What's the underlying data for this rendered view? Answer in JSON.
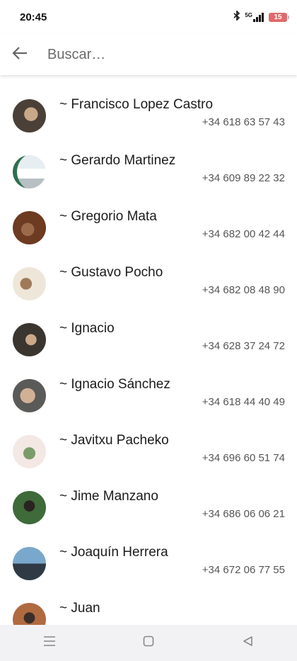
{
  "status_bar": {
    "time": "20:45",
    "battery": "15",
    "network": "5G"
  },
  "search": {
    "placeholder": "Buscar…",
    "value": ""
  },
  "contacts": [
    {
      "name": "~ Francisco Lopez Castro",
      "phone": "+34 618 63 57 43",
      "avatar_colors": [
        "#4a4038",
        "#c8a888"
      ]
    },
    {
      "name": "~ Gerardo Martinez",
      "phone": "+34 609 89 22 32",
      "avatar_colors": [
        "#e6eef2",
        "#2d6f4e"
      ]
    },
    {
      "name": "~ Gregorio Mata",
      "phone": "+34 682 00 42 44",
      "avatar_colors": [
        "#6d3a22",
        "#9a6a4a"
      ]
    },
    {
      "name": "~ Gustavo Pocho",
      "phone": "+34 682 08 48 90",
      "avatar_colors": [
        "#efe6da",
        "#a07a58"
      ]
    },
    {
      "name": "~ Ignacio",
      "phone": "+34 628 37 24 72",
      "avatar_colors": [
        "#3b3530",
        "#caa98a"
      ]
    },
    {
      "name": "~ Ignacio Sánchez",
      "phone": "+34 618 44 40 49",
      "avatar_colors": [
        "#5a5a58",
        "#d2b096"
      ]
    },
    {
      "name": "~ Javitxu Pacheko",
      "phone": "+34 696 60 51 74",
      "avatar_colors": [
        "#f3e8e4",
        "#7a9c6a"
      ]
    },
    {
      "name": "~ Jime Manzano",
      "phone": "+34 686 06 06 21",
      "avatar_colors": [
        "#3f6a3a",
        "#2a2420"
      ]
    },
    {
      "name": "~ Joaquín Herrera",
      "phone": "+34 672 06 77 55",
      "avatar_colors": [
        "#7aa8cc",
        "#2f3a44"
      ]
    },
    {
      "name": "~ Juan",
      "phone": "",
      "avatar_colors": [
        "#b06a40",
        "#3a2e28"
      ]
    }
  ],
  "nav": {
    "icons": [
      "menu-icon",
      "home-square-icon",
      "back-triangle-icon"
    ]
  }
}
